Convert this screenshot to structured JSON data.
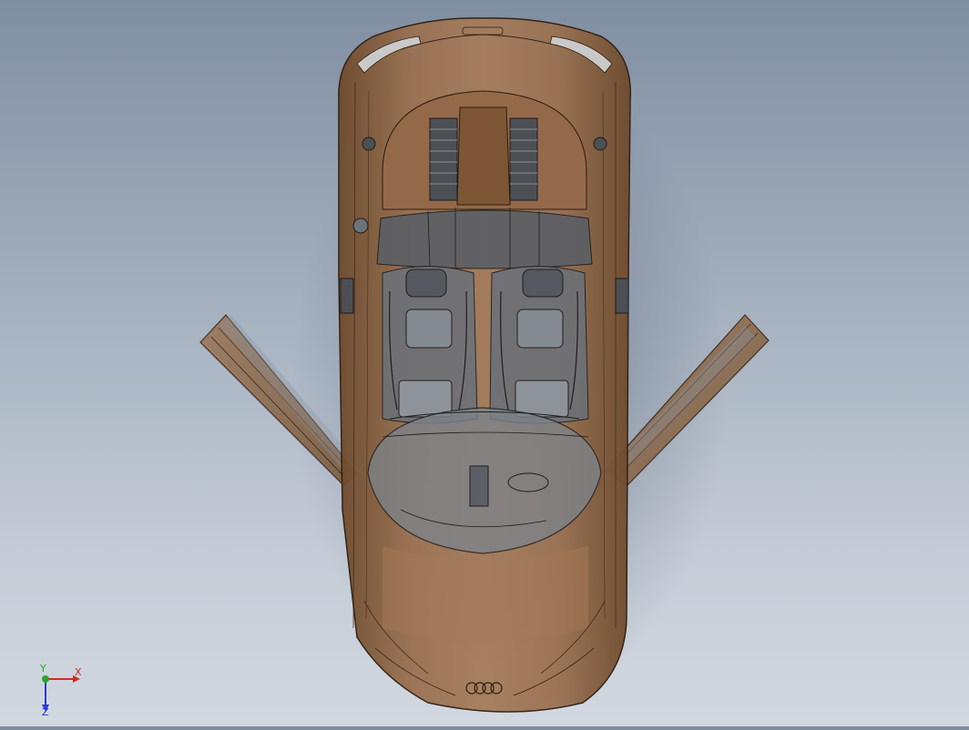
{
  "viewport": {
    "background_top": "#7f8ea1",
    "background_bottom": "#d2d8e0",
    "model": {
      "subject": "convertible-car-top-view",
      "body_color": "#8a6240",
      "edge_color": "#3a2414",
      "glass_color": "#6f7478",
      "doors_state": "open"
    }
  },
  "triad": {
    "x_label": "X",
    "y_label": "Y",
    "z_label": "Z",
    "x_color": "#d22a2a",
    "y_color": "#2aa52a",
    "z_color": "#2a3ad2"
  }
}
